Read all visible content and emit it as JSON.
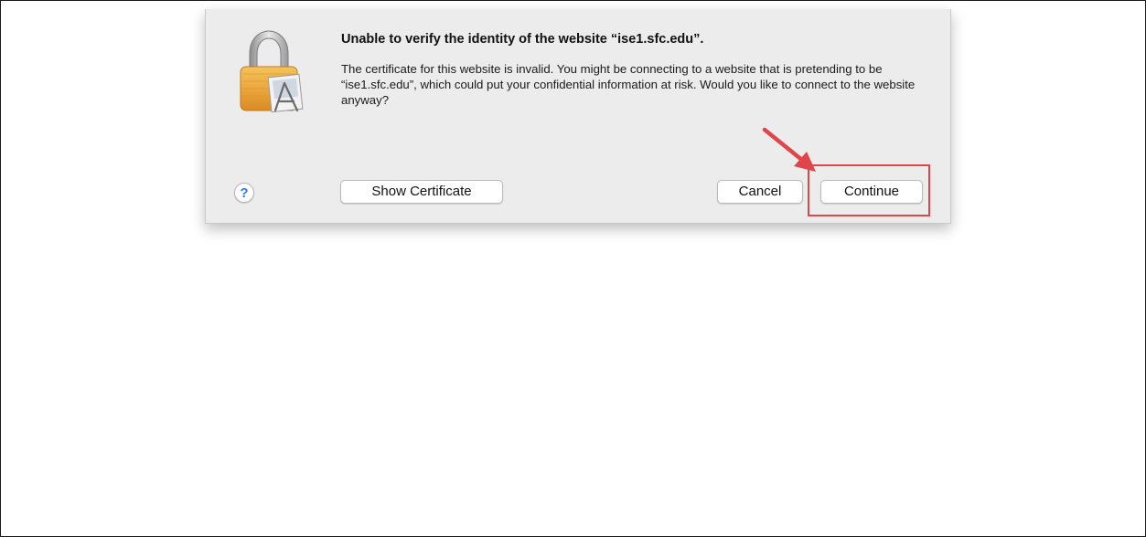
{
  "dialog": {
    "title": "Unable to verify the identity of the website “ise1.sfc.edu”.",
    "message": "The certificate for this website is invalid. You might be connecting to a website that is pretending to be “ise1.sfc.edu”, which could put your confidential information at risk. Would you like to connect to the website anyway?",
    "icon": "padlock-icon",
    "help_label": "?",
    "buttons": {
      "show_certificate": "Show Certificate",
      "cancel": "Cancel",
      "continue": "Continue"
    }
  },
  "annotation": {
    "type": "arrow-and-box",
    "target": "continue-button",
    "color": "#e0454a"
  },
  "colors": {
    "dialog_bg": "#ececec",
    "help_blue": "#2f7bf0",
    "annotation_red": "#e0454a"
  }
}
